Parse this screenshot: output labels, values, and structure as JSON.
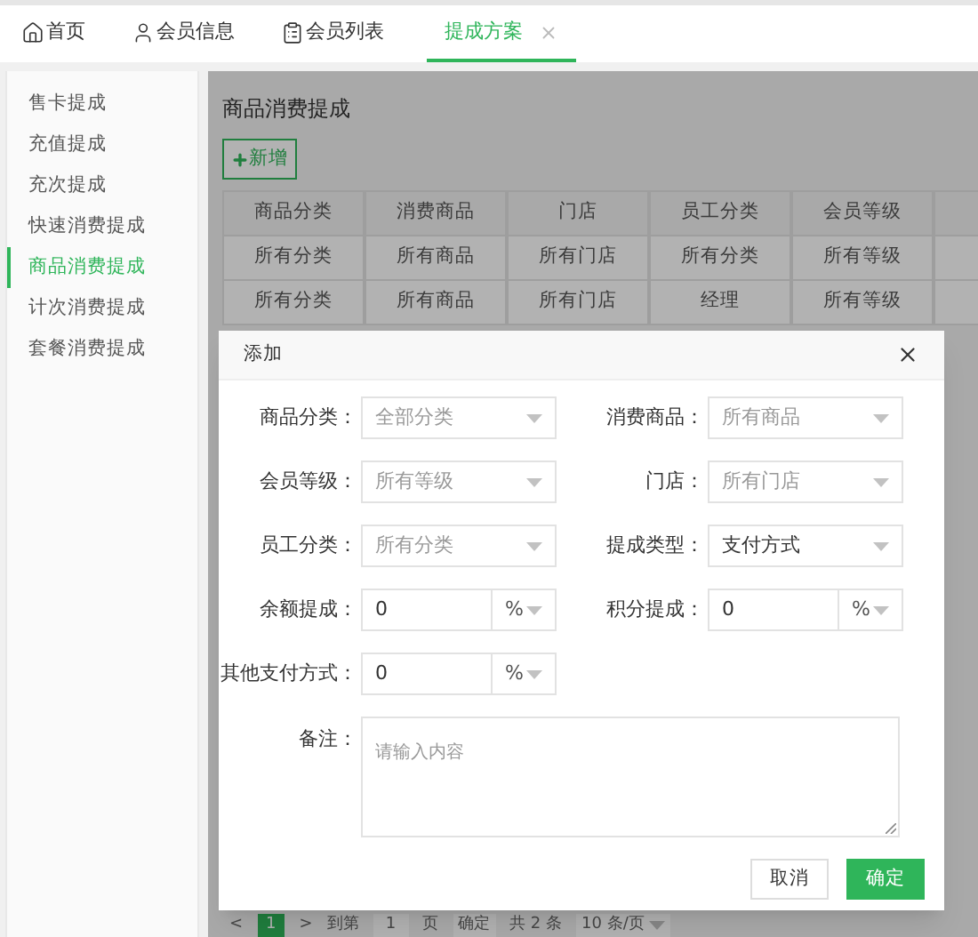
{
  "tabs": [
    {
      "label": "首页",
      "selected": false,
      "closable": false
    },
    {
      "label": "会员信息",
      "selected": false,
      "closable": false
    },
    {
      "label": "会员列表",
      "selected": false,
      "closable": false
    },
    {
      "label": "提成方案",
      "selected": true,
      "closable": true
    }
  ],
  "sidebar": {
    "items": [
      {
        "label": "售卡提成",
        "selected": false
      },
      {
        "label": "充值提成",
        "selected": false
      },
      {
        "label": "充次提成",
        "selected": false
      },
      {
        "label": "快速消费提成",
        "selected": false
      },
      {
        "label": "商品消费提成",
        "selected": true
      },
      {
        "label": "计次消费提成",
        "selected": false
      },
      {
        "label": "套餐消费提成",
        "selected": false
      }
    ]
  },
  "page_title": "商品消费提成",
  "add_button": "新增",
  "table": {
    "columns": [
      "商品分类",
      "消费商品",
      "门店",
      "员工分类",
      "会员等级"
    ],
    "rows": [
      [
        "所有分类",
        "所有商品",
        "所有门店",
        "所有分类",
        "所有等级"
      ],
      [
        "所有分类",
        "所有商品",
        "所有门店",
        "经理",
        "所有等级"
      ]
    ]
  },
  "pagination": {
    "prev": "<",
    "page": "1",
    "next": ">",
    "goto_label": "到第",
    "page_input": "1",
    "page_unit": "页",
    "go_button": "确定",
    "total": "共 2 条",
    "page_size": "10 条/页"
  },
  "dialog": {
    "title": "添加",
    "fields": [
      {
        "kind": "select",
        "label": "商品分类：",
        "placeholder": "全部分类"
      },
      {
        "kind": "select",
        "label": "消费商品：",
        "placeholder": "所有商品"
      },
      {
        "kind": "select",
        "label": "会员等级：",
        "placeholder": "所有等级"
      },
      {
        "kind": "select",
        "label": "门店：",
        "placeholder": "所有门店"
      },
      {
        "kind": "select",
        "label": "员工分类：",
        "placeholder": "所有分类"
      },
      {
        "kind": "select",
        "label": "提成类型：",
        "value": "支付方式"
      },
      {
        "kind": "percent",
        "label": "余额提成：",
        "value": "0",
        "unit": "%"
      },
      {
        "kind": "percent",
        "label": "积分提成：",
        "value": "0",
        "unit": "%"
      },
      {
        "kind": "percent",
        "label": "其他支付方式：",
        "value": "0",
        "unit": "%"
      },
      {
        "kind": "textarea",
        "label": "备注：",
        "placeholder": "请输入内容"
      }
    ],
    "buttons": [
      {
        "kind": "secondary",
        "label": "取消"
      },
      {
        "kind": "primary",
        "label": "确定"
      }
    ]
  }
}
